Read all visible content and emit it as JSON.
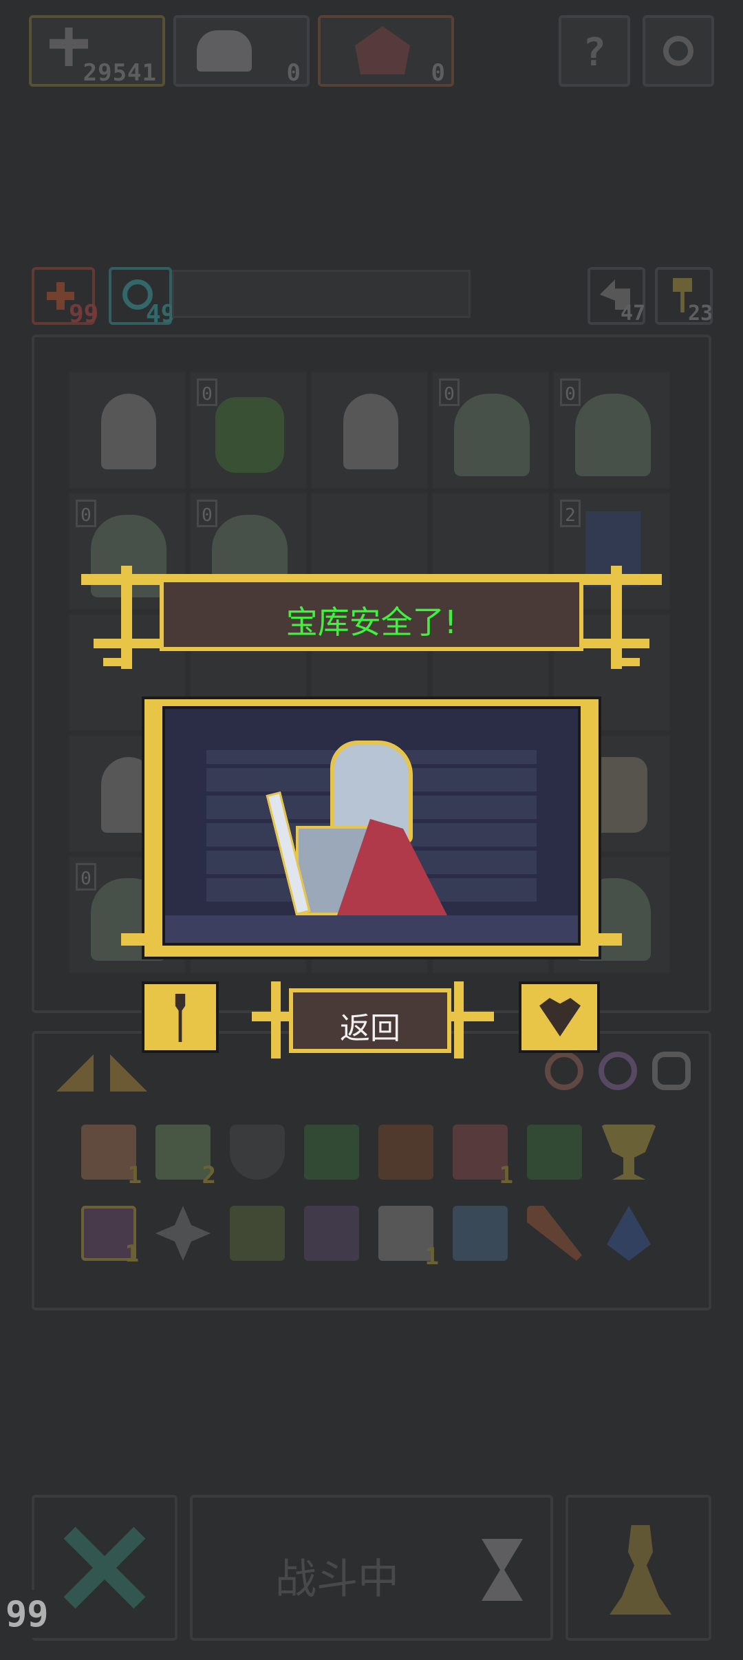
{
  "top_bar": {
    "coins": "29541",
    "item_a_count": "0",
    "item_b_count": "0",
    "help_label": "?",
    "settings_icon": "gear-icon"
  },
  "stats_row": {
    "attack_value": "99",
    "defense_value": "49",
    "turns_value": "47",
    "keys_value": "23"
  },
  "grid": {
    "badges": [
      "0",
      "0",
      "0",
      "0",
      "0",
      "2",
      "0"
    ]
  },
  "dialog": {
    "title": "宝库安全了!",
    "return_label": "返回"
  },
  "inventory": {
    "counts": [
      "1",
      "2",
      "1",
      "1",
      "1"
    ]
  },
  "bottom_bar": {
    "battle_label": "战斗中",
    "corner_number": "99"
  },
  "colors": {
    "background": "#2d2e30",
    "gold_frame": "#e8c547",
    "title_text": "#3ef23e",
    "dialog_panel": "#4a3a37",
    "scene_bg": "#2a2d45"
  }
}
